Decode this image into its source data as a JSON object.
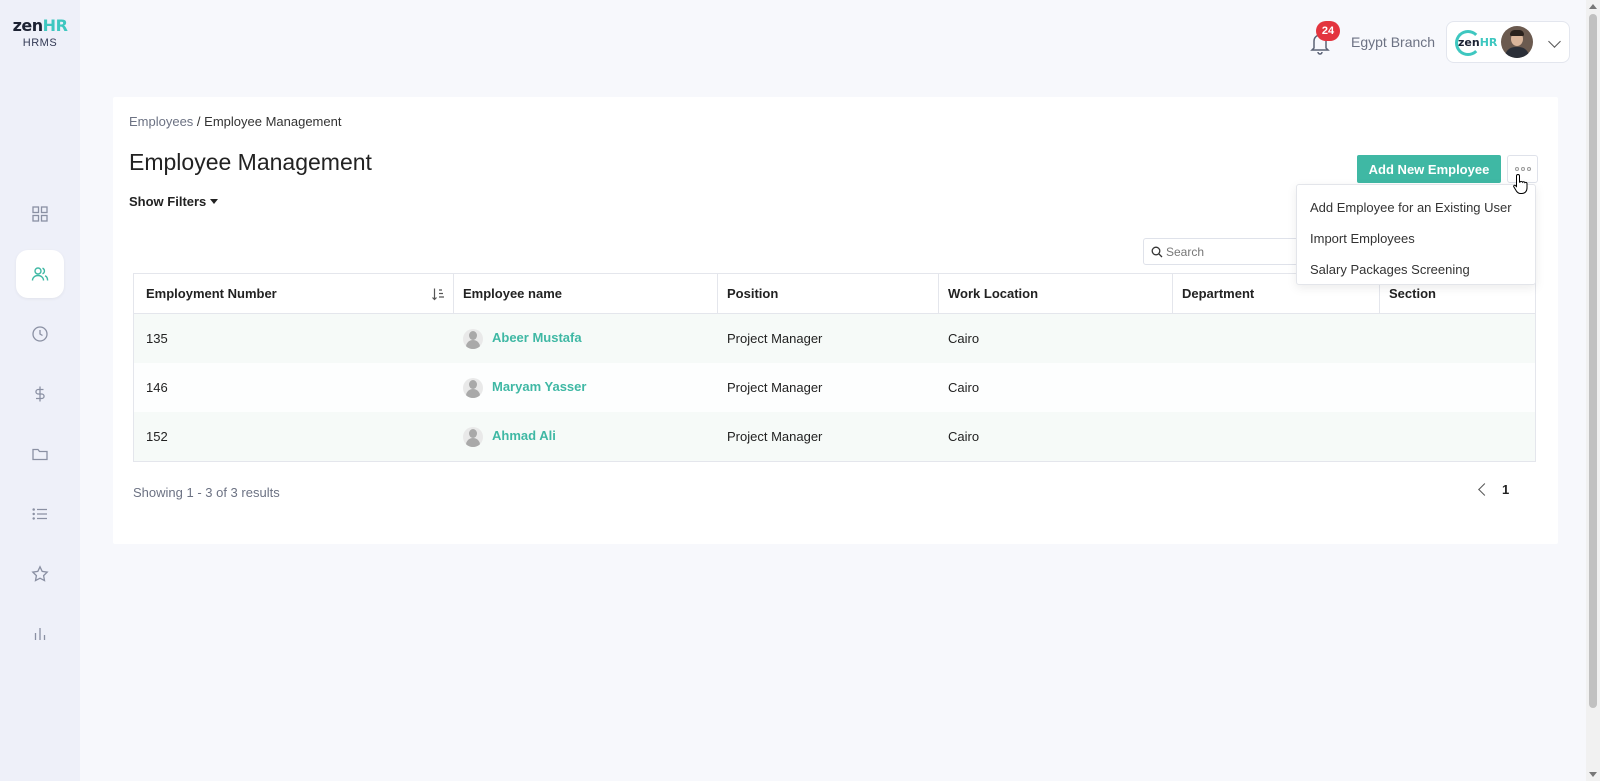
{
  "brand": {
    "logo_text_main": "zen",
    "logo_text_accent": "HR",
    "logo_subtitle": "HRMS"
  },
  "sidebar": {
    "items": [
      {
        "name": "dashboard",
        "icon": "grid-icon",
        "active": false
      },
      {
        "name": "employees",
        "icon": "users-icon",
        "active": true
      },
      {
        "name": "time",
        "icon": "clock-icon",
        "active": false
      },
      {
        "name": "payroll",
        "icon": "dollar-icon",
        "active": false
      },
      {
        "name": "documents",
        "icon": "folder-icon",
        "active": false
      },
      {
        "name": "lists",
        "icon": "list-icon",
        "active": false
      },
      {
        "name": "performance",
        "icon": "star-icon",
        "active": false
      },
      {
        "name": "reports",
        "icon": "bar-chart-icon",
        "active": false
      }
    ]
  },
  "header": {
    "notification_count": "24",
    "branch": "Egypt Branch",
    "company_logo_main": "zen",
    "company_logo_accent": "HR"
  },
  "page": {
    "breadcrumb_parent": "Employees",
    "breadcrumb_separator": " / ",
    "breadcrumb_current": "Employee Management",
    "title": "Employee Management",
    "show_filters": "Show Filters",
    "add_button": "Add New Employee",
    "search_placeholder": "Search"
  },
  "dropdown": {
    "items": [
      "Add Employee for an Existing User",
      "Import Employees",
      "Salary Packages Screening"
    ]
  },
  "table": {
    "columns": [
      "Employment Number",
      "Employee name",
      "Position",
      "Work Location",
      "Department",
      "Section"
    ],
    "rows": [
      {
        "number": "135",
        "name": "Abeer Mustafa",
        "position": "Project Manager",
        "location": "Cairo",
        "department": "",
        "section": ""
      },
      {
        "number": "146",
        "name": "Maryam Yasser",
        "position": "Project Manager",
        "location": "Cairo",
        "department": "",
        "section": ""
      },
      {
        "number": "152",
        "name": "Ahmad Ali",
        "position": "Project Manager",
        "location": "Cairo",
        "department": "",
        "section": ""
      }
    ]
  },
  "pagination": {
    "summary": "Showing 1 - 3 of 3 results",
    "current_page": "1"
  },
  "colors": {
    "accent": "#3fb8a4",
    "brand_teal": "#3ec7c0",
    "badge": "#e3343e",
    "sidebar_bg": "#eef0f9"
  }
}
